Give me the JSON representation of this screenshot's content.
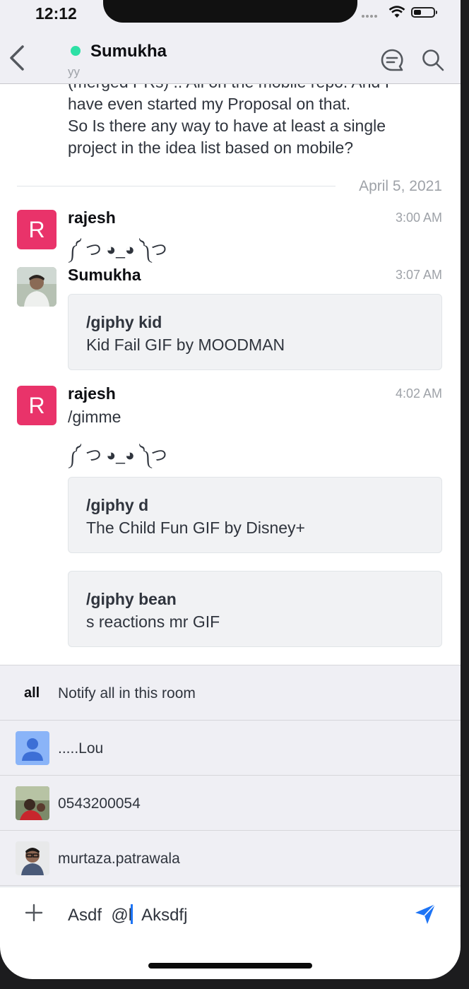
{
  "status": {
    "time": "12:12"
  },
  "header": {
    "name": "Sumukha",
    "subtitle": "yy"
  },
  "previous_message": {
    "lines": [
      "(merged PRs) .. All on the mobile repo. And I",
      "have even started my Proposal on that.",
      "So Is there any way to have at least a single",
      "project in the idea list based on mobile?"
    ]
  },
  "date_divider": "April 5, 2021",
  "messages": [
    {
      "initial": "R",
      "user": "rajesh",
      "time": "3:00 AM",
      "text": "༼ つ ◕_◕ ༽つ"
    },
    {
      "user": "Sumukha",
      "time": "3:07 AM",
      "attachment": {
        "command": "/giphy kid",
        "title": "Kid Fail GIF by MOODMAN"
      }
    },
    {
      "initial": "R",
      "user": "rajesh",
      "time": "4:02 AM",
      "text": "/gimme",
      "text2": "༼ つ ◕_◕ ༽つ",
      "attachments": [
        {
          "command": "/giphy d",
          "title": "The Child Fun GIF by Disney+"
        },
        {
          "command": "/giphy bean",
          "title": "s reactions mr GIF"
        }
      ]
    }
  ],
  "mentions": [
    {
      "label": "all",
      "description": "Notify all in this room"
    },
    {
      "label": ".....Lou"
    },
    {
      "label": "0543200054"
    },
    {
      "label": "murtaza.patrawala"
    }
  ],
  "composer": {
    "before_cursor": "Asdf  @l",
    "after_cursor": "  Aksdfj"
  },
  "colors": {
    "accent": "#1d74f5",
    "online": "#2de0a5",
    "avatar_r": "#e9336a",
    "header_bg": "#efeff4"
  }
}
